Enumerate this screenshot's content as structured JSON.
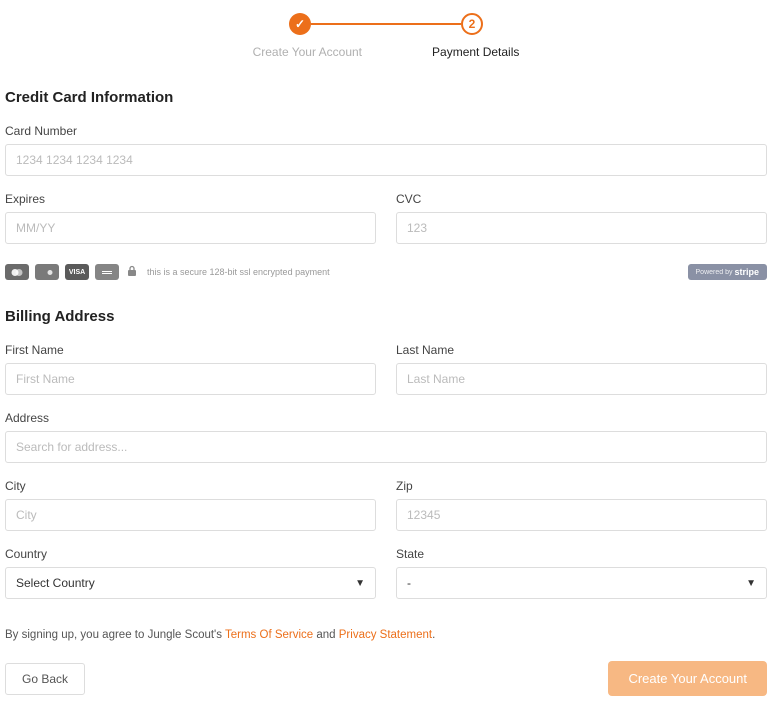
{
  "stepper": {
    "step1_label": "Create Your Account",
    "step2_label": "Payment Details",
    "step2_number": "2",
    "step1_check": "✓"
  },
  "cc_section": {
    "title": "Credit Card Information",
    "card_number_label": "Card Number",
    "card_number_placeholder": "1234 1234 1234 1234",
    "expires_label": "Expires",
    "expires_placeholder": "MM/YY",
    "cvc_label": "CVC",
    "cvc_placeholder": "123",
    "secure_text": "this is a secure 128-bit ssl encrypted payment",
    "visa_text": "VISA",
    "stripe_powered": "Powered by",
    "stripe_name": "stripe"
  },
  "billing": {
    "title": "Billing Address",
    "first_name_label": "First Name",
    "first_name_placeholder": "First Name",
    "last_name_label": "Last Name",
    "last_name_placeholder": "Last Name",
    "address_label": "Address",
    "address_placeholder": "Search for address...",
    "city_label": "City",
    "city_placeholder": "City",
    "zip_label": "Zip",
    "zip_placeholder": "12345",
    "country_label": "Country",
    "country_selected": "Select Country",
    "state_label": "State",
    "state_selected": "-"
  },
  "agree": {
    "prefix": "By signing up, you agree to Jungle Scout's ",
    "tos": "Terms Of Service",
    "and": " and ",
    "privacy": "Privacy Statement",
    "suffix": "."
  },
  "buttons": {
    "back": "Go Back",
    "submit": "Create Your Account"
  }
}
